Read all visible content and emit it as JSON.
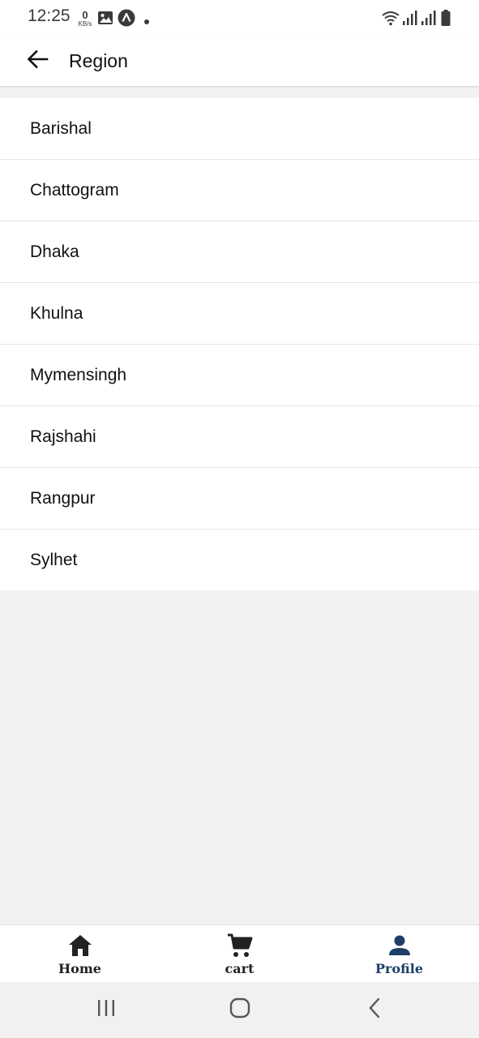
{
  "status_bar": {
    "time": "12:25",
    "net_speed_value": "0",
    "net_speed_unit": "KB/s",
    "icons": [
      "image-icon",
      "app-a-icon",
      "dot-icon",
      "wifi-icon",
      "signal-icon",
      "signal-icon",
      "battery-icon"
    ]
  },
  "app_bar": {
    "back_icon": "arrow-left-icon",
    "title": "Region"
  },
  "regions": [
    {
      "label": "Barishal"
    },
    {
      "label": "Chattogram"
    },
    {
      "label": "Dhaka"
    },
    {
      "label": "Khulna"
    },
    {
      "label": "Mymensingh"
    },
    {
      "label": "Rajshahi"
    },
    {
      "label": "Rangpur"
    },
    {
      "label": "Sylhet"
    }
  ],
  "bottom_nav": {
    "items": [
      {
        "label": "Home",
        "icon": "home-icon",
        "color": "#222222"
      },
      {
        "label": "cart",
        "icon": "cart-icon",
        "color": "#222222"
      },
      {
        "label": "Profile",
        "icon": "person-icon",
        "color": "#1d3f66",
        "active": true
      }
    ]
  },
  "system_nav": {
    "items": [
      "recents-icon",
      "home-circle-icon",
      "back-chevron-icon"
    ]
  },
  "colors": {
    "accent": "#1d3f66",
    "background": "#f2f2f2",
    "surface": "#ffffff"
  }
}
